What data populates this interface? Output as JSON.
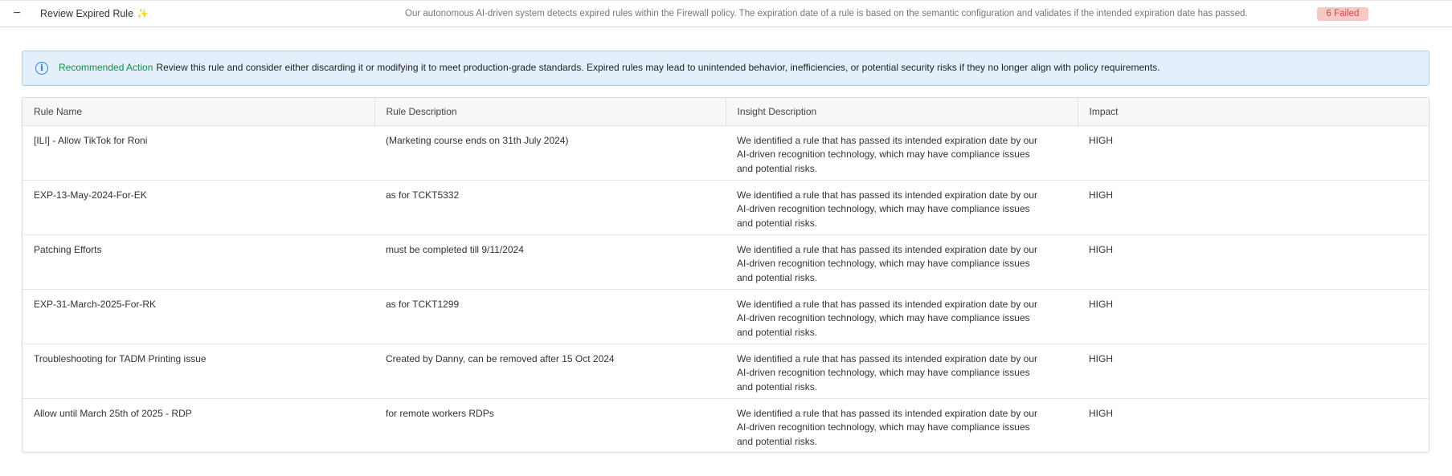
{
  "check": {
    "title": "Review Expired Rule",
    "sparkle": "✨",
    "description": "Our autonomous AI-driven system detects expired rules within the Firewall policy. The expiration date of a rule is based on the semantic configuration and validates if the intended expiration date has passed.",
    "status": "6 Failed",
    "status_color": "#d64545",
    "status_bg": "#f6c9c9"
  },
  "banner": {
    "label": "Recommended Action",
    "message": "Review this rule and consider either discarding it or modifying it to meet production-grade standards. Expired rules may lead to unintended behavior, inefficiencies, or potential security risks if they no longer align with policy requirements.",
    "icon": "info-icon"
  },
  "table": {
    "columns": [
      "Rule Name",
      "Rule Description",
      "Insight Description",
      "Impact"
    ],
    "rows": [
      {
        "name": "[ILI] - Allow TikTok for Roni",
        "description": "(Marketing course ends on 31th July 2024)",
        "insight": "We identified a rule that has passed its intended expiration date by our AI-driven recognition technology, which may have compliance issues and potential risks.",
        "impact": "HIGH"
      },
      {
        "name": "EXP-13-May-2024-For-EK",
        "description": "as for TCKT5332",
        "insight": "We identified a rule that has passed its intended expiration date by our AI-driven recognition technology, which may have compliance issues and potential risks.",
        "impact": "HIGH"
      },
      {
        "name": "Patching Efforts",
        "description": "must be completed till 9/11/2024",
        "insight": "We identified a rule that has passed its intended expiration date by our AI-driven recognition technology, which may have compliance issues and potential risks.",
        "impact": "HIGH"
      },
      {
        "name": "EXP-31-March-2025-For-RK",
        "description": "as for TCKT1299",
        "insight": "We identified a rule that has passed its intended expiration date by our AI-driven recognition technology, which may have compliance issues and potential risks.",
        "impact": "HIGH"
      },
      {
        "name": "Troubleshooting for TADM Printing issue",
        "description": "Created by Danny, can be removed after 15 Oct 2024",
        "insight": "We identified a rule that has passed its intended expiration date by our AI-driven recognition technology, which may have compliance issues and potential risks.",
        "impact": "HIGH"
      },
      {
        "name": "Allow until March 25th of 2025 - RDP",
        "description": "for remote workers RDPs",
        "insight": "We identified a rule that has passed its intended expiration date by our AI-driven recognition technology, which may have compliance issues and potential risks.",
        "impact": "HIGH"
      }
    ]
  }
}
